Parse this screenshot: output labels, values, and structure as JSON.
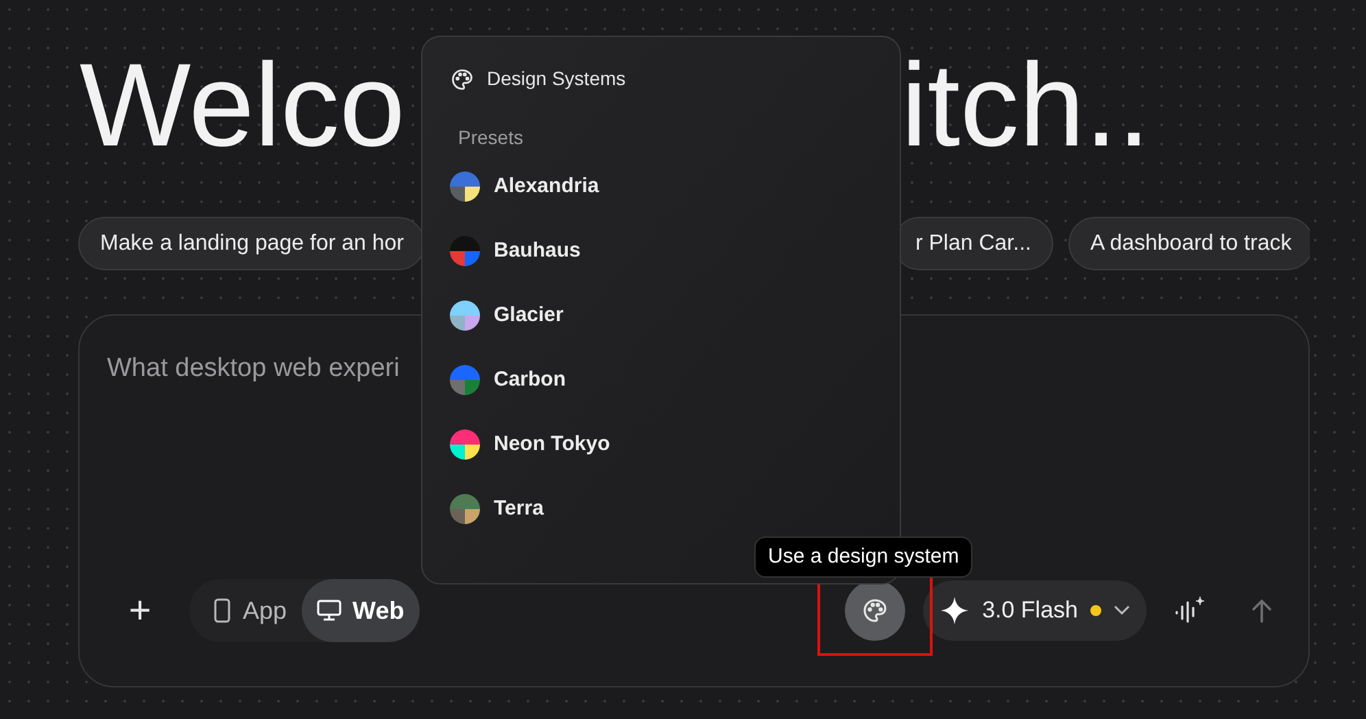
{
  "headline": {
    "left": "Welco",
    "right": "itch.."
  },
  "suggestions": [
    {
      "label": "Make a landing page for an hor"
    },
    {
      "label": "r Plan Car..."
    },
    {
      "label": "A dashboard to track"
    }
  ],
  "prompt": {
    "placeholder": "What desktop web experi"
  },
  "toolbar": {
    "add": "+",
    "modes": [
      {
        "label": "App",
        "kind": "phone",
        "selected": false
      },
      {
        "label": "Web",
        "kind": "desktop",
        "selected": true
      }
    ],
    "model": "3.0 Flash",
    "model_status": {
      "color": "#f5c518"
    }
  },
  "tooltip": "Use a design system",
  "menu": {
    "title": "Design Systems",
    "section": "Presets",
    "items": [
      {
        "label": "Alexandria",
        "swatch": [
          {
            "color": "#3a6fd8"
          },
          {
            "color": "#5a5d63"
          },
          {
            "color": "#f6e27a"
          }
        ]
      },
      {
        "label": "Bauhaus",
        "swatch": [
          {
            "color": "#111111"
          },
          {
            "color": "#e53935"
          },
          {
            "color": "#1565ff"
          }
        ]
      },
      {
        "label": "Glacier",
        "swatch": [
          {
            "color": "#7fd1fb"
          },
          {
            "color": "#8fb4c8"
          },
          {
            "color": "#c9a6ef"
          }
        ]
      },
      {
        "label": "Carbon",
        "swatch": [
          {
            "color": "#1a66ff"
          },
          {
            "color": "#6f6f6f"
          },
          {
            "color": "#198038"
          }
        ]
      },
      {
        "label": "Neon Tokyo",
        "swatch": [
          {
            "color": "#ff2d78"
          },
          {
            "color": "#00f0d0"
          },
          {
            "color": "#ffe14d"
          }
        ]
      },
      {
        "label": "Terra",
        "swatch": [
          {
            "color": "#4f7a53"
          },
          {
            "color": "#6b6258"
          },
          {
            "color": "#c8a46a"
          }
        ]
      }
    ]
  }
}
